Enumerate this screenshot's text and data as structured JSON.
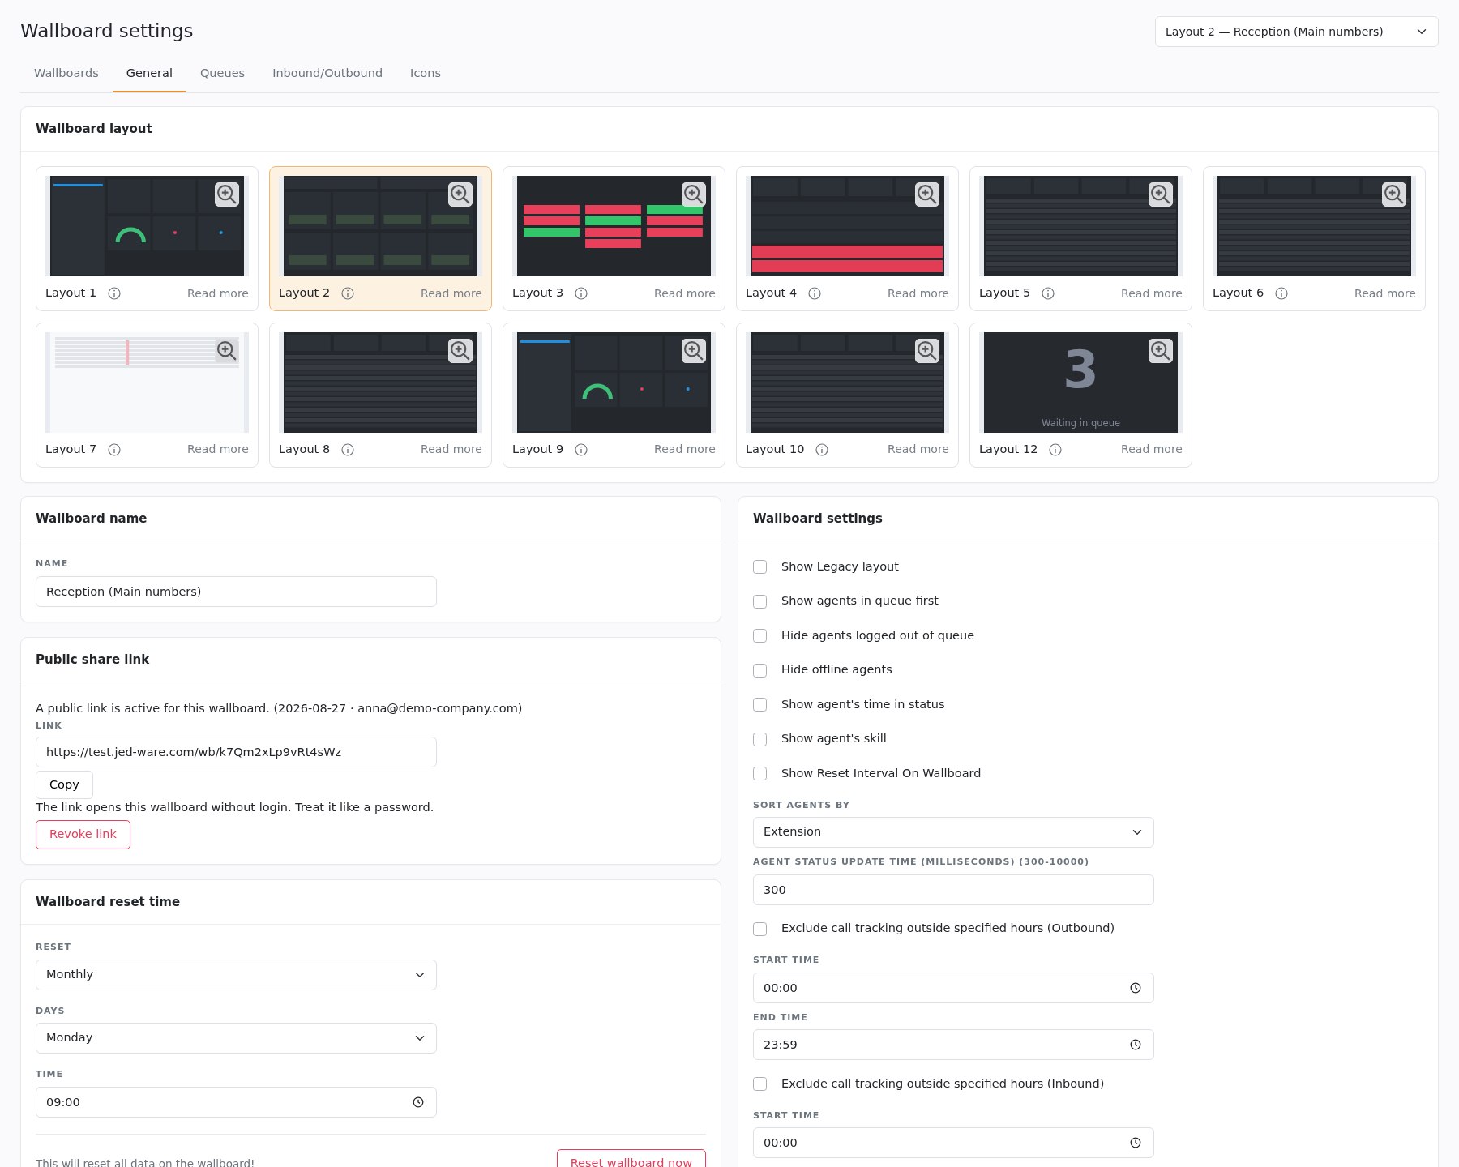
{
  "page": {
    "title": "Wallboard settings",
    "wallboard_select": "Layout 2 — Reception (Main numbers)"
  },
  "tabs": [
    {
      "label": "Wallboards",
      "selected": false
    },
    {
      "label": "General",
      "selected": true
    },
    {
      "label": "Queues",
      "selected": false
    },
    {
      "label": "Inbound/Outbound",
      "selected": false
    },
    {
      "label": "Icons",
      "selected": false
    }
  ],
  "layout_card": {
    "title": "Wallboard layout",
    "layouts": [
      {
        "label": "Layout 1",
        "read_more": "Read more",
        "selected": false,
        "preview": {
          "kind": "stats"
        }
      },
      {
        "label": "Layout 2",
        "read_more": "Read more",
        "selected": true,
        "preview": {
          "kind": "grid"
        }
      },
      {
        "label": "Layout 3",
        "read_more": "Read more",
        "selected": false,
        "preview": {
          "kind": "tiles"
        }
      },
      {
        "label": "Layout 4",
        "read_more": "Read more",
        "selected": false,
        "preview": {
          "kind": "rows"
        }
      },
      {
        "label": "Layout 5",
        "read_more": "Read more",
        "selected": false,
        "preview": {
          "kind": "table"
        }
      },
      {
        "label": "Layout 6",
        "read_more": "Read more",
        "selected": false,
        "preview": {
          "kind": "table"
        }
      },
      {
        "label": "Layout 7",
        "read_more": "Read more",
        "selected": false,
        "preview": {
          "kind": "light"
        }
      },
      {
        "label": "Layout 8",
        "read_more": "Read more",
        "selected": false,
        "preview": {
          "kind": "table"
        }
      },
      {
        "label": "Layout 9",
        "read_more": "Read more",
        "selected": false,
        "preview": {
          "kind": "stats"
        }
      },
      {
        "label": "Layout 10",
        "read_more": "Read more",
        "selected": false,
        "preview": {
          "kind": "table"
        }
      },
      {
        "label": "Layout 12",
        "read_more": "Read more",
        "selected": false,
        "preview": {
          "kind": "number",
          "big_text": "3",
          "caption": "Waiting in queue"
        }
      }
    ]
  },
  "name_card": {
    "title": "Wallboard name",
    "field_label": "NAME",
    "value": "Reception (Main numbers)"
  },
  "share_card": {
    "title": "Public share link",
    "status": "A public link is active for this wallboard. (2026-08-27 · anna@demo-company.com)",
    "field_label": "LINK",
    "value": "https://test.jed-ware.com/wb/k7Qm2xLp9vRt4sWz",
    "copy_button": "Copy",
    "note": "The link opens this wallboard without login. Treat it like a password.",
    "revoke_button": "Revoke link"
  },
  "reset_card": {
    "title": "Wallboard reset time",
    "fields": [
      {
        "kind": "select",
        "label": "RESET",
        "value": "Monthly"
      },
      {
        "kind": "select",
        "label": "DAYS",
        "value": "Monday"
      },
      {
        "kind": "time",
        "label": "TIME",
        "value": "09:00"
      }
    ],
    "warning": "This will reset all data on the wallboard!",
    "reset_button": "Reset wallboard now"
  },
  "settings_card": {
    "title": "Wallboard settings",
    "items": [
      {
        "kind": "checkbox",
        "label": "Show Legacy layout",
        "checked": false
      },
      {
        "kind": "checkbox",
        "label": "Show agents in queue first",
        "checked": false
      },
      {
        "kind": "checkbox",
        "label": "Hide agents logged out of queue",
        "checked": false
      },
      {
        "kind": "checkbox",
        "label": "Hide offline agents",
        "checked": false
      },
      {
        "kind": "checkbox",
        "label": "Show agent's time in status",
        "checked": false
      },
      {
        "kind": "checkbox",
        "label": "Show agent's skill",
        "checked": false
      },
      {
        "kind": "checkbox",
        "label": "Show Reset Interval On Wallboard",
        "checked": false
      },
      {
        "kind": "select",
        "label": "SORT AGENTS BY",
        "value": "Extension"
      },
      {
        "kind": "text",
        "label": "AGENT STATUS UPDATE TIME (MILLISECONDS) (300-10000)",
        "value": "300"
      },
      {
        "kind": "checkbox",
        "label": "Exclude call tracking outside specified hours (Outbound)",
        "checked": false
      },
      {
        "kind": "time",
        "label": "START TIME",
        "value": "00:00"
      },
      {
        "kind": "time",
        "label": "END TIME",
        "value": "23:59"
      },
      {
        "kind": "checkbox",
        "label": "Exclude call tracking outside specified hours (Inbound)",
        "checked": false
      },
      {
        "kind": "time",
        "label": "START TIME",
        "value": "00:00"
      }
    ]
  }
}
